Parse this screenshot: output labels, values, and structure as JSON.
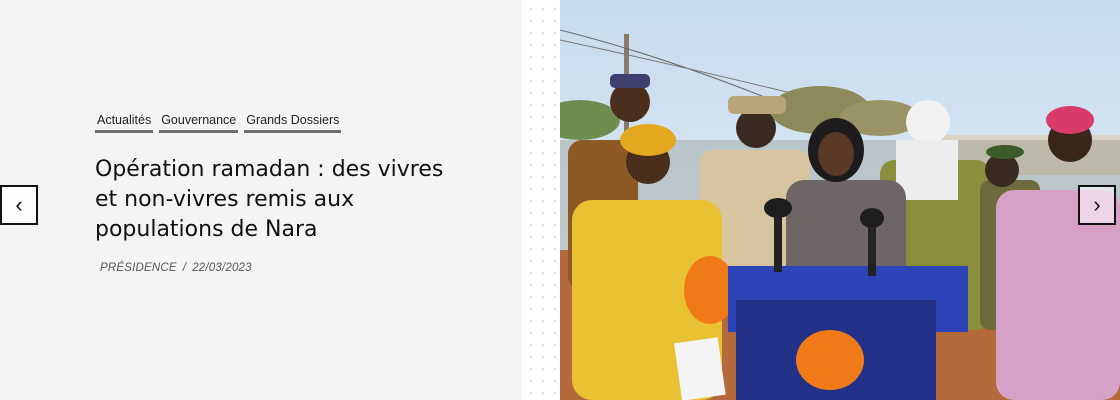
{
  "categories": [
    "Actualités",
    "Gouvernance",
    "Grands Dossiers"
  ],
  "article": {
    "title": "Opération ramadan : des vivres et non-vivres remis aux populations de Nara",
    "author": "PRÉSIDENCE",
    "separator": "/",
    "date": "22/03/2023"
  },
  "nav": {
    "prev_icon": "‹",
    "next_icon": "›"
  },
  "colors": {
    "panel_bg": "#f3f4f6",
    "category_underline": "#6d6d6d",
    "podium_blue": "#2d44b8"
  }
}
